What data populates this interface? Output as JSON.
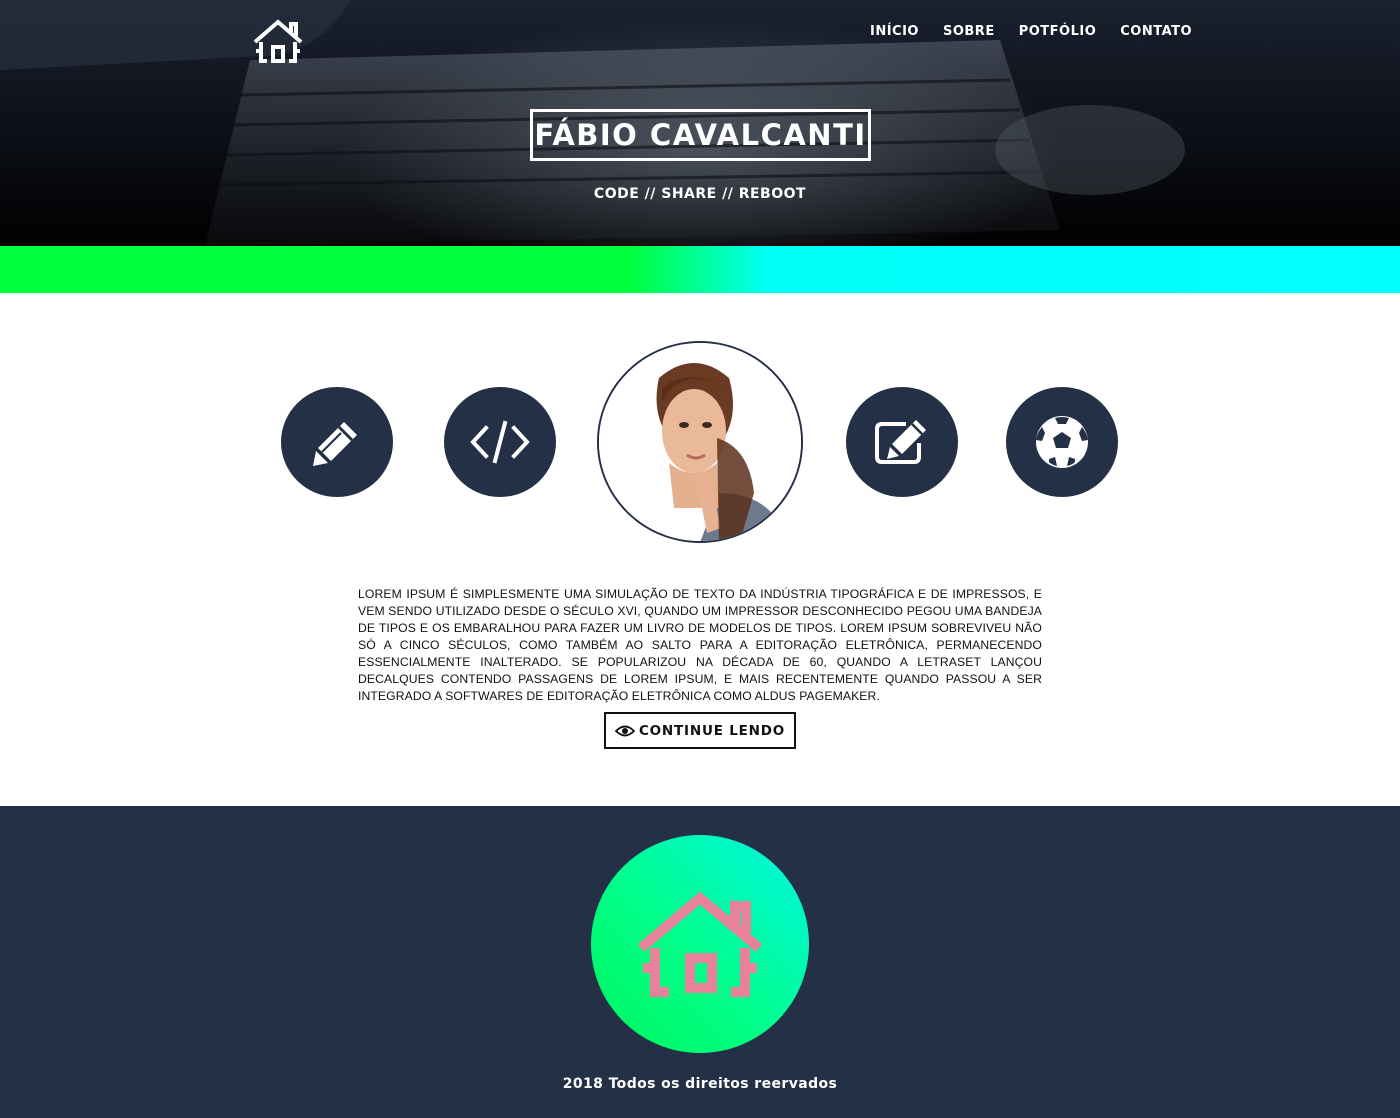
{
  "header": {
    "logo_icon": "house-icon",
    "nav": [
      {
        "label": "INÍCIO"
      },
      {
        "label": "SOBRE"
      },
      {
        "label": "POTFÓLIO"
      },
      {
        "label": "CONTATO"
      }
    ],
    "title": "FÁBIO CAVALCANTI",
    "subtitle": "CODE // SHARE // REBOOT"
  },
  "band": {
    "colors": [
      "#00ff3c",
      "#00ffff"
    ]
  },
  "features": {
    "icons": [
      "pencil-icon",
      "code-icon",
      "profile-photo",
      "edit-icon",
      "soccer-ball-icon"
    ],
    "circle_color": "#243045"
  },
  "about": {
    "text": "Lorem Ipsum é simplesmente uma simulação de texto da indústria tipográfica e de impressos, e vem sendo utilizado desde o século XVI, quando um impressor desconhecido pegou uma bandeja de tipos e os embaralhou para fazer um livro de modelos de tipos. Lorem Ipsum sobreviveu não só a cinco séculos, como também ao salto para a editoração eletrônica, permanecendo essencialmente inalterado. Se popularizou na década de 60, quando a Letraset lançou decalques contendo passagens de Lorem Ipsum, e mais recentemente quando passou a ser integrado a softwares de editoração eletrônica como Aldus PageMaker.",
    "button_icon": "eye-icon",
    "button_label": "CONTINUE LENDO"
  },
  "footer": {
    "logo_icon": "house-icon",
    "logo_color": "#e8829a",
    "copyright": "2018 Todos os direitos reervados",
    "background": "#243045"
  }
}
